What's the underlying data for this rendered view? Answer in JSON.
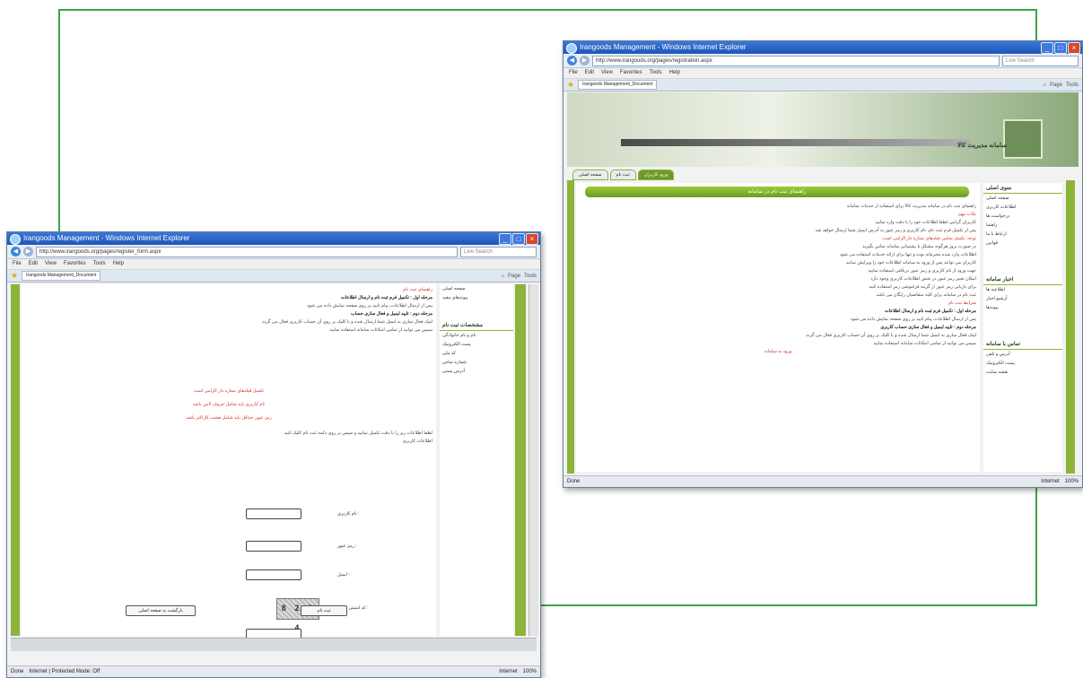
{
  "colors": {
    "frame": "#3aa64a",
    "accent_green": "#8cb43a",
    "title_blue": "#1f55b8"
  },
  "back_window": {
    "title": "Irangoods Management - Windows Internet Explorer",
    "address": "http://www.irangoods.org/pages/registration.aspx",
    "search_placeholder": "Live Search",
    "menu": [
      "File",
      "Edit",
      "View",
      "Favorites",
      "Tools",
      "Help"
    ],
    "tab_label": "Irangoods Management_Document",
    "tools": [
      "Page",
      "Tools"
    ],
    "banner_title": "سامانه مدیریت کالا",
    "nav_tabs": [
      "صفحه اصلی",
      "ثبت نام",
      "ورود کاربران"
    ],
    "section_heading": "راهنمای ثبت نام در سامانه",
    "sidebar": {
      "heading1": "منوی اصلی",
      "items1": [
        "صفحه اصلی",
        "اطلاعات کاربری",
        "درخواست ها",
        "راهنما",
        "ارتباط با ما",
        "قوانین"
      ],
      "heading2": "اخبار سامانه",
      "items2": [
        "اطلاعیه ها",
        "آرشیو اخبار",
        "پیوندها"
      ],
      "heading3": "تماس با سامانه",
      "items3": [
        "آدرس و تلفن",
        "پست الکترونیک",
        "نقشه سایت"
      ]
    },
    "status_left": "Done",
    "status_zone": "Internet",
    "status_zoom": "100%"
  },
  "front_window": {
    "title": "Irangoods Management - Windows Internet Explorer",
    "address": "http://www.irangoods.org/pages/register_form.aspx",
    "search_placeholder": "Live Search",
    "menu": [
      "File",
      "Edit",
      "View",
      "Favorites",
      "Tools",
      "Help"
    ],
    "tab_label": "Irangoods Management_Document",
    "tools": [
      "Page",
      "Tools"
    ],
    "sidebar": {
      "items_top": [
        "صفحه اصلی",
        "پیوندهای مفید"
      ],
      "heading": "مشخصات ثبت نام",
      "items": [
        "نام و نام خانوادگی",
        "پست الکترونیک",
        "کد ملی",
        "شماره تماس",
        "آدرس پستی"
      ]
    },
    "form": {
      "labels": [
        "نام کاربری :",
        "رمز عبور :",
        "ایمیل :",
        "کد امنیتی را وارد کنید :"
      ],
      "captcha_text": "8 2 3 4",
      "submit_label": "ثبت نام",
      "cancel_label": "بازگشت به صفحه اصلی"
    },
    "status_left": "Done",
    "status_mid": "Internet | Protected Mode: Off",
    "status_zone": "Internet",
    "status_zoom": "100%"
  }
}
